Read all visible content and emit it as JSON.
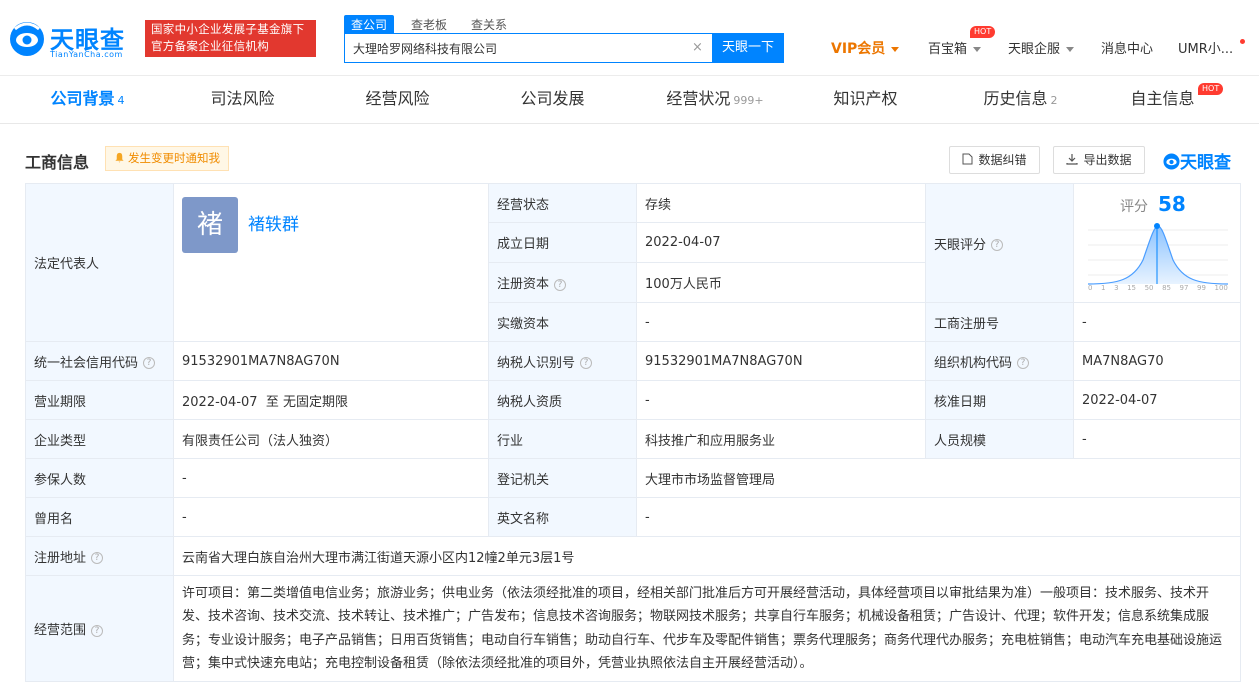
{
  "header": {
    "logo_name": "天眼查",
    "logo_url": "TianYanCha.com",
    "gov_badge_line1": "国家中小企业发展子基金旗下",
    "gov_badge_line2": "官方备案企业征信机构",
    "search_tabs": [
      "查公司",
      "查老板",
      "查关系"
    ],
    "search_value": "大理哈罗网络科技有限公司",
    "search_clear": "×",
    "search_button": "天眼一下",
    "nav": {
      "vip": "VIP会员",
      "baibao": "百宝箱",
      "hot": "HOT",
      "qifu": "天眼企服",
      "messages": "消息中心",
      "user": "UMR小..."
    }
  },
  "tabs": [
    {
      "label": "公司背景",
      "count": "4"
    },
    {
      "label": "司法风险",
      "count": ""
    },
    {
      "label": "经营风险",
      "count": ""
    },
    {
      "label": "公司发展",
      "count": ""
    },
    {
      "label": "经营状况",
      "count": "999+"
    },
    {
      "label": "知识产权",
      "count": ""
    },
    {
      "label": "历史信息",
      "count": "2"
    },
    {
      "label": "自主信息",
      "count": ""
    }
  ],
  "tab_hot": "HOT",
  "section": {
    "title": "工商信息",
    "notice": "发生变更时通知我",
    "btn_correct": "数据纠错",
    "btn_export": "导出数据",
    "watermark": "天眼查"
  },
  "info": {
    "legal_rep_label": "法定代表人",
    "legal_rep_avatar": "褚",
    "legal_rep_name": "褚轶群",
    "status_label": "经营状态",
    "status_value": "存续",
    "found_label": "成立日期",
    "found_value": "2022-04-07",
    "capital_label": "注册资本",
    "capital_value": "100万人民币",
    "paid_label": "实缴资本",
    "paid_value": "-",
    "score_label": "天眼评分",
    "score_title": "评分",
    "score_value": "58",
    "score_axis": [
      "0",
      "1",
      "3",
      "15",
      "50",
      "85",
      "97",
      "99",
      "100"
    ],
    "regno_label": "工商注册号",
    "regno_value": "-",
    "credit_label": "统一社会信用代码",
    "credit_value": "91532901MA7N8AG70N",
    "taxid_label": "纳税人识别号",
    "taxid_value": "91532901MA7N8AG70N",
    "orgcode_label": "组织机构代码",
    "orgcode_value": "MA7N8AG70",
    "period_label": "营业期限",
    "period_value": "2022-04-07  至 无固定期限",
    "taxqual_label": "纳税人资质",
    "taxqual_value": "-",
    "approve_label": "核准日期",
    "approve_value": "2022-04-07",
    "type_label": "企业类型",
    "type_value": "有限责任公司（法人独资）",
    "industry_label": "行业",
    "industry_value": "科技推广和应用服务业",
    "staff_label": "人员规模",
    "staff_value": "-",
    "insured_label": "参保人数",
    "insured_value": "-",
    "authority_label": "登记机关",
    "authority_value": "大理市市场监督管理局",
    "former_label": "曾用名",
    "former_value": "-",
    "english_label": "英文名称",
    "english_value": "-",
    "address_label": "注册地址",
    "address_value": "云南省大理白族自治州大理市满江街道天源小区内12幢2单元3层1号",
    "scope_label": "经营范围",
    "scope_value": "许可项目：第二类增值电信业务；旅游业务；供电业务（依法须经批准的项目，经相关部门批准后方可开展经营活动，具体经营项目以审批结果为准）一般项目：技术服务、技术开发、技术咨询、技术交流、技术转让、技术推广；广告发布；信息技术咨询服务；物联网技术服务；共享自行车服务；机械设备租赁；广告设计、代理；软件开发；信息系统集成服务；专业设计服务；电子产品销售；日用百货销售；电动自行车销售；助动自行车、代步车及零配件销售；票务代理服务；商务代理代办服务；充电桩销售；电动汽车充电基础设施运营；集中式快速充电站；充电控制设备租赁（除依法须经批准的项目外，凭营业执照依法自主开展经营活动）。"
  },
  "colors": {
    "brand": "#0084ff",
    "vip": "#ec7600",
    "badge": "#e2382f",
    "label_bg": "#f2f8ff"
  }
}
